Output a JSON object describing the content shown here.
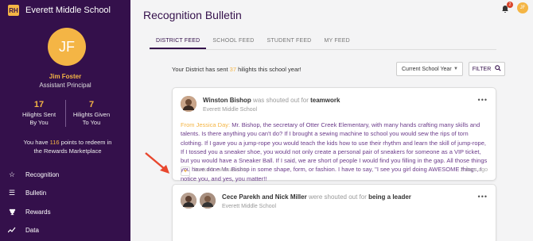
{
  "brand": {
    "name": "Everett Middle School",
    "logo_text": "RH"
  },
  "user": {
    "initials": "JF",
    "name": "Jim Foster",
    "role": "Assistant Principal",
    "stats": [
      {
        "value": "17",
        "label_line1": "Hilights Sent",
        "label_line2": "By You"
      },
      {
        "value": "7",
        "label_line1": "Hilights Given",
        "label_line2": "To You"
      }
    ],
    "points_prefix": "You have ",
    "points_value": "116",
    "points_suffix": " points to redeem in",
    "points_line2": "the Rewards Marketplace"
  },
  "nav": [
    {
      "icon": "star-icon",
      "glyph": "☆",
      "label": "Recognition"
    },
    {
      "icon": "list-icon",
      "glyph": "☰",
      "label": "Bulletin"
    },
    {
      "icon": "trophy-icon",
      "glyph": "🏆",
      "label": "Rewards"
    },
    {
      "icon": "trend-icon",
      "glyph": "↗",
      "label": "Data"
    }
  ],
  "header": {
    "title": "Recognition Bulletin",
    "notification_count": "2",
    "avatar_initials": "JF"
  },
  "tabs": [
    "DISTRICT FEED",
    "SCHOOL FEED",
    "STUDENT FEED",
    "MY FEED"
  ],
  "summary": {
    "prefix": "Your District has sent ",
    "count": "37",
    "suffix": " hilights this school year!"
  },
  "filters": {
    "select_value": "Current School Year",
    "filter_label": "FILTER"
  },
  "posts": [
    {
      "name": "Winston Bishop",
      "muted": " was shouted out for ",
      "category": "teamwork",
      "school": "Everett Middle School",
      "from": "From Jessica Day:",
      "body": " Mr. Bishop, the secretary of Otter Creek Elementary, with many hands crafting many skills and talents. Is there anything you can't do? If I brought a sewing machine to school you would sew the rips of torn clothing. If I gave you a jump-rope you would teach the kids how to use their rhythm and learn the skill of jump-rope, If I tossed you a sneaker shoe, you would not only create a personal pair of sneakers for someone as a VIP ticket, but you would have a Sneaker Ball. If I said, we are short of people I would find you filling in the gap. All those things you have done Mr. Bishop in some shape, form, or fashion. I have to say, \"I see you girl doing AWESOME things, I notice you, and yes, you matter!!",
      "celebrated": "Jessica D. celebrated this!",
      "time": "2 days ago"
    },
    {
      "name": "Cece Parekh and Nick Miller",
      "muted": " were shouted out for ",
      "category": "being a leader",
      "school": "Everett Middle School"
    }
  ],
  "colors": {
    "sidebar": "#34104b",
    "accent": "#f4b545",
    "body_text": "#6b3b8a",
    "arrow": "#e8472e"
  }
}
